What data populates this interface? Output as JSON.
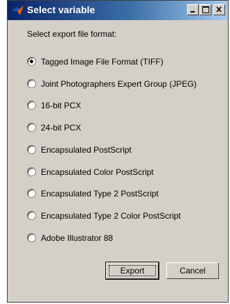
{
  "window": {
    "title": "Select variable",
    "icon": "matlab-logo-icon"
  },
  "titlebar_buttons": [
    "minimize-icon",
    "maximize-icon",
    "close-icon"
  ],
  "prompt": "Select export file format:",
  "options": [
    {
      "label": "Tagged Image File Format (TIFF)",
      "checked": true
    },
    {
      "label": "Joint Photographers Expert Group (JPEG)",
      "checked": false
    },
    {
      "label": "16-bit PCX",
      "checked": false
    },
    {
      "label": "24-bit PCX",
      "checked": false
    },
    {
      "label": "Encapsulated PostScript",
      "checked": false
    },
    {
      "label": "Encapsulated Color PostScript",
      "checked": false
    },
    {
      "label": "Encapsulated Type 2 PostScript",
      "checked": false
    },
    {
      "label": "Encapsulated Type 2 Color PostScript",
      "checked": false
    },
    {
      "label": "Adobe Illustrator 88",
      "checked": false
    }
  ],
  "buttons": {
    "export": "Export",
    "cancel": "Cancel"
  }
}
